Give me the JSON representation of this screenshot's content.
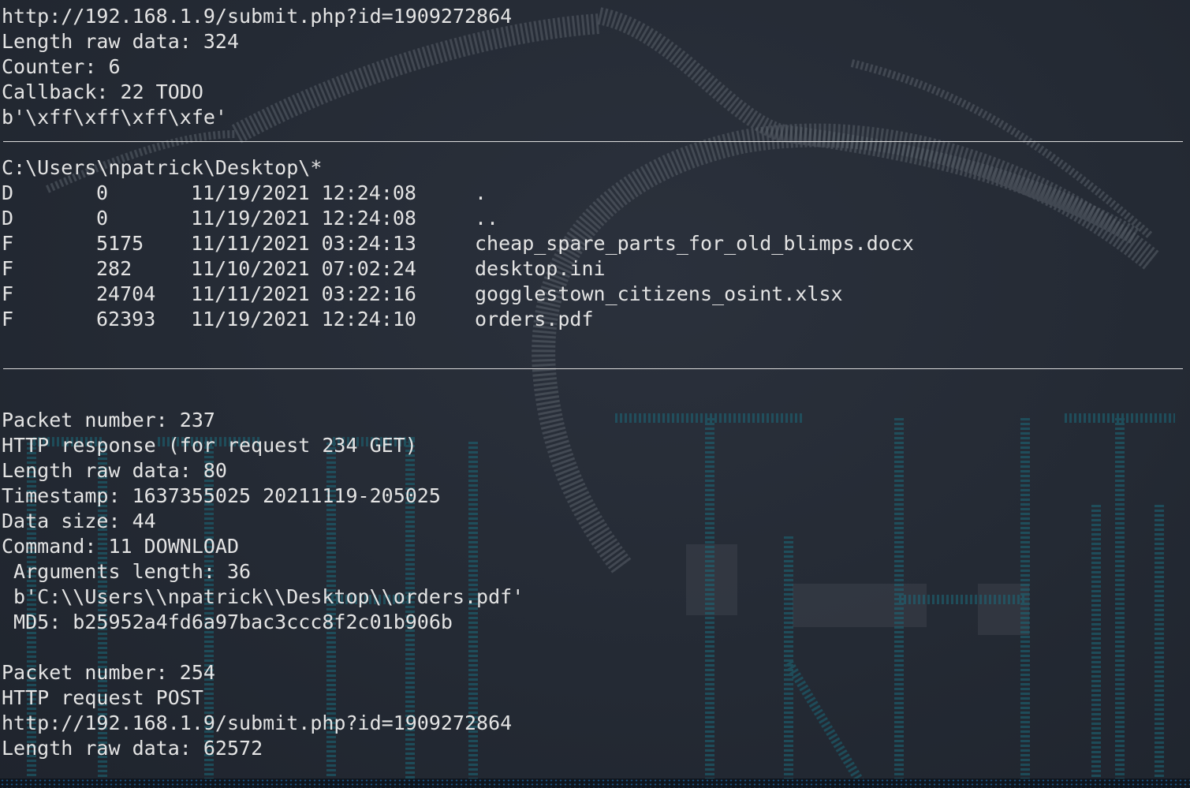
{
  "block1": {
    "url": "http://192.168.1.9/submit.php?id=1909272864",
    "length_raw": "Length raw data: 324",
    "counter": "Counter: 6",
    "callback": "Callback: 22 TODO",
    "bytes": "b'\\xff\\xff\\xff\\xfe'"
  },
  "listing": {
    "path": "C:\\Users\\npatrick\\Desktop\\*",
    "rows": [
      {
        "type": "D",
        "size": "0",
        "datetime": "11/19/2021 12:24:08",
        "name": "."
      },
      {
        "type": "D",
        "size": "0",
        "datetime": "11/19/2021 12:24:08",
        "name": ".."
      },
      {
        "type": "F",
        "size": "5175",
        "datetime": "11/11/2021 03:24:13",
        "name": "cheap_spare_parts_for_old_blimps.docx"
      },
      {
        "type": "F",
        "size": "282",
        "datetime": "11/10/2021 07:02:24",
        "name": "desktop.ini"
      },
      {
        "type": "F",
        "size": "24704",
        "datetime": "11/11/2021 03:22:16",
        "name": "gogglestown_citizens_osint.xlsx"
      },
      {
        "type": "F",
        "size": "62393",
        "datetime": "11/19/2021 12:24:10",
        "name": "orders.pdf"
      }
    ]
  },
  "packet237": {
    "number": "Packet number: 237",
    "http": "HTTP response (for request 234 GET)",
    "length_raw": "Length raw data: 80",
    "timestamp": "Timestamp: 1637355025 20211119-205025",
    "data_size": "Data size: 44",
    "command": "Command: 11 DOWNLOAD",
    "args_length": " Arguments length: 36",
    "args": " b'C:\\\\Users\\\\npatrick\\\\Desktop\\\\orders.pdf'",
    "md5": " MD5: b25952a4fd6a97bac3ccc8f2c01b906b"
  },
  "packet254": {
    "number": "Packet number: 254",
    "http": "HTTP request POST",
    "url": "http://192.168.1.9/submit.php?id=1909272864",
    "length_raw": "Length raw data: 62572"
  },
  "colors": {
    "background": "#242a35",
    "text": "#e4e4e4",
    "separator": "#dcdcdc",
    "art_gray": "#5a6069",
    "art_teal": "#1b6a7a"
  }
}
